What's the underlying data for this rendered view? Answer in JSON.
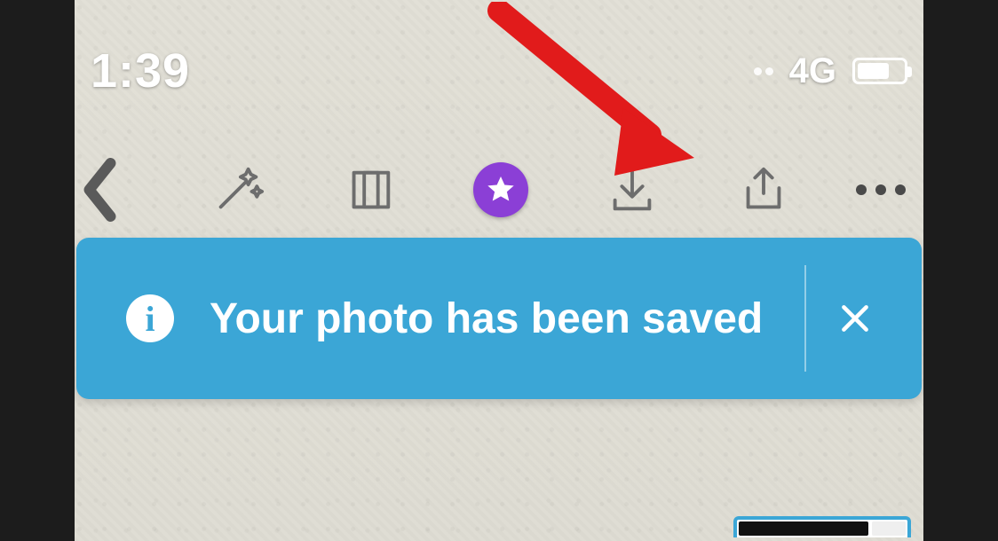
{
  "statusbar": {
    "time": "1:39",
    "network": "4G"
  },
  "toolbar": {
    "back": "Back",
    "magic": "Magic",
    "crop": "Crop",
    "favorite": "Favorite",
    "download": "Download",
    "share": "Share",
    "more": "More"
  },
  "toast": {
    "message": "Your photo has been saved",
    "close": "Close"
  },
  "annotation": {
    "arrow_target": "download-button"
  }
}
